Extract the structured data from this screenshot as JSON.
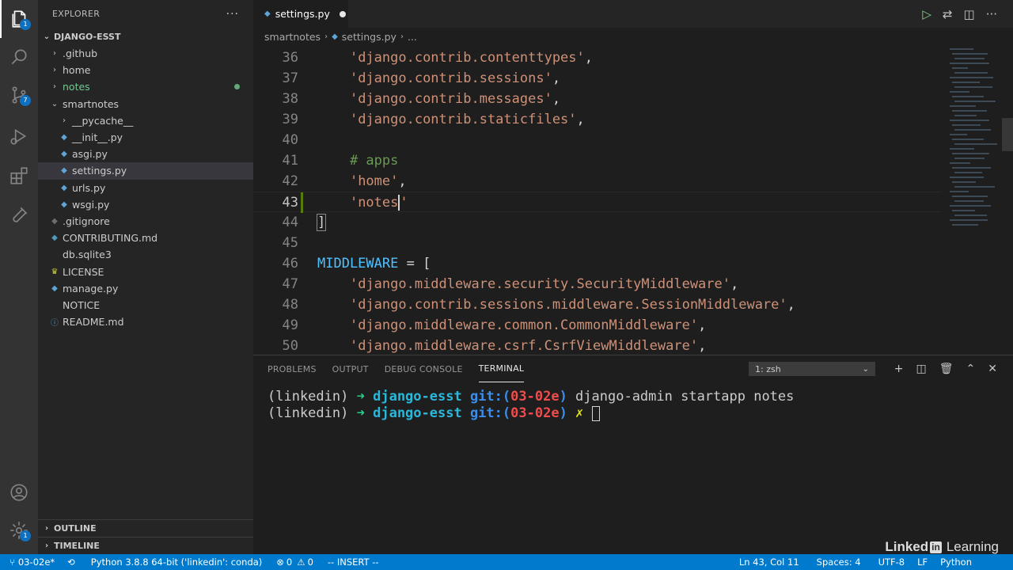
{
  "activity_bar": {
    "explorer_badge": "1",
    "source_control_badge": "7",
    "settings_badge": "1"
  },
  "sidebar": {
    "title": "EXPLORER",
    "more": "···",
    "project": "DJANGO-ESST",
    "tree": [
      {
        "label": ".github",
        "type": "folder",
        "depth": 1
      },
      {
        "label": "home",
        "type": "folder",
        "depth": 1
      },
      {
        "label": "notes",
        "type": "folder",
        "depth": 1,
        "status": "untracked"
      },
      {
        "label": "smartnotes",
        "type": "folder-open",
        "depth": 1
      },
      {
        "label": "__pycache__",
        "type": "folder",
        "depth": 2
      },
      {
        "label": "__init__.py",
        "type": "py",
        "depth": 2
      },
      {
        "label": "asgi.py",
        "type": "py",
        "depth": 2
      },
      {
        "label": "settings.py",
        "type": "py",
        "depth": 2,
        "selected": true
      },
      {
        "label": "urls.py",
        "type": "py",
        "depth": 2
      },
      {
        "label": "wsgi.py",
        "type": "py",
        "depth": 2
      },
      {
        "label": ".gitignore",
        "type": "git",
        "depth": 1
      },
      {
        "label": "CONTRIBUTING.md",
        "type": "md",
        "depth": 1
      },
      {
        "label": "db.sqlite3",
        "type": "plain",
        "depth": 1
      },
      {
        "label": "LICENSE",
        "type": "license",
        "depth": 1
      },
      {
        "label": "manage.py",
        "type": "py",
        "depth": 1
      },
      {
        "label": "NOTICE",
        "type": "plain",
        "depth": 1
      },
      {
        "label": "README.md",
        "type": "info",
        "depth": 1
      }
    ],
    "outline": "OUTLINE",
    "timeline": "TIMELINE"
  },
  "tab": {
    "label": "settings.py"
  },
  "breadcrumb": {
    "folder": "smartnotes",
    "file": "settings.py",
    "more": "..."
  },
  "editor": {
    "lines": [
      {
        "n": "36",
        "indent": "    ",
        "kind": "str",
        "text": "'django.contrib.contenttypes'",
        "tail": ","
      },
      {
        "n": "37",
        "indent": "    ",
        "kind": "str",
        "text": "'django.contrib.sessions'",
        "tail": ","
      },
      {
        "n": "38",
        "indent": "    ",
        "kind": "str",
        "text": "'django.contrib.messages'",
        "tail": ","
      },
      {
        "n": "39",
        "indent": "    ",
        "kind": "str",
        "text": "'django.contrib.staticfiles'",
        "tail": ","
      },
      {
        "n": "40",
        "indent": "",
        "kind": "blank",
        "text": "",
        "tail": ""
      },
      {
        "n": "41",
        "indent": "    ",
        "kind": "cmt",
        "text": "# apps",
        "tail": ""
      },
      {
        "n": "42",
        "indent": "    ",
        "kind": "str",
        "text": "'home'",
        "tail": ","
      },
      {
        "n": "43",
        "indent": "    ",
        "kind": "cursor",
        "text": "'notes",
        "tail": "'"
      },
      {
        "n": "44",
        "indent": "",
        "kind": "bracket",
        "text": "]",
        "tail": ""
      },
      {
        "n": "45",
        "indent": "",
        "kind": "blank",
        "text": "",
        "tail": ""
      },
      {
        "n": "46",
        "indent": "",
        "kind": "var",
        "text": "MIDDLEWARE",
        "tail": " = ["
      },
      {
        "n": "47",
        "indent": "    ",
        "kind": "str",
        "text": "'django.middleware.security.SecurityMiddleware'",
        "tail": ","
      },
      {
        "n": "48",
        "indent": "    ",
        "kind": "str",
        "text": "'django.contrib.sessions.middleware.SessionMiddleware'",
        "tail": ","
      },
      {
        "n": "49",
        "indent": "    ",
        "kind": "str",
        "text": "'django.middleware.common.CommonMiddleware'",
        "tail": ","
      },
      {
        "n": "50",
        "indent": "    ",
        "kind": "str",
        "text": "'django.middleware.csrf.CsrfViewMiddleware'",
        "tail": ","
      }
    ]
  },
  "panel": {
    "tabs": [
      "PROBLEMS",
      "OUTPUT",
      "DEBUG CONSOLE",
      "TERMINAL"
    ],
    "active_tab": "TERMINAL",
    "shell_select": "1: zsh",
    "terminal": [
      {
        "env": "(linkedin)",
        "arrow": "➜",
        "dir": "django-esst",
        "git": "git:(",
        "branch": "03-02e",
        "close": ")",
        "cmd": " django-admin startapp notes"
      },
      {
        "env": "(linkedin)",
        "arrow": "➜",
        "dir": "django-esst",
        "git": "git:(",
        "branch": "03-02e",
        "close": ")",
        "cmd": " ✗ "
      }
    ]
  },
  "statusbar": {
    "branch": "03-02e*",
    "interpreter": "Python 3.8.8 64-bit ('linkedin': conda)",
    "errors": "0",
    "warnings": "0",
    "mode": "-- INSERT --",
    "position": "Ln 43, Col 11",
    "spaces": "Spaces: 4",
    "encoding": "UTF-8",
    "eol": "LF",
    "language": "Python"
  },
  "watermark": {
    "brand": "Linked",
    "in": "in",
    "suffix": "Learning"
  }
}
